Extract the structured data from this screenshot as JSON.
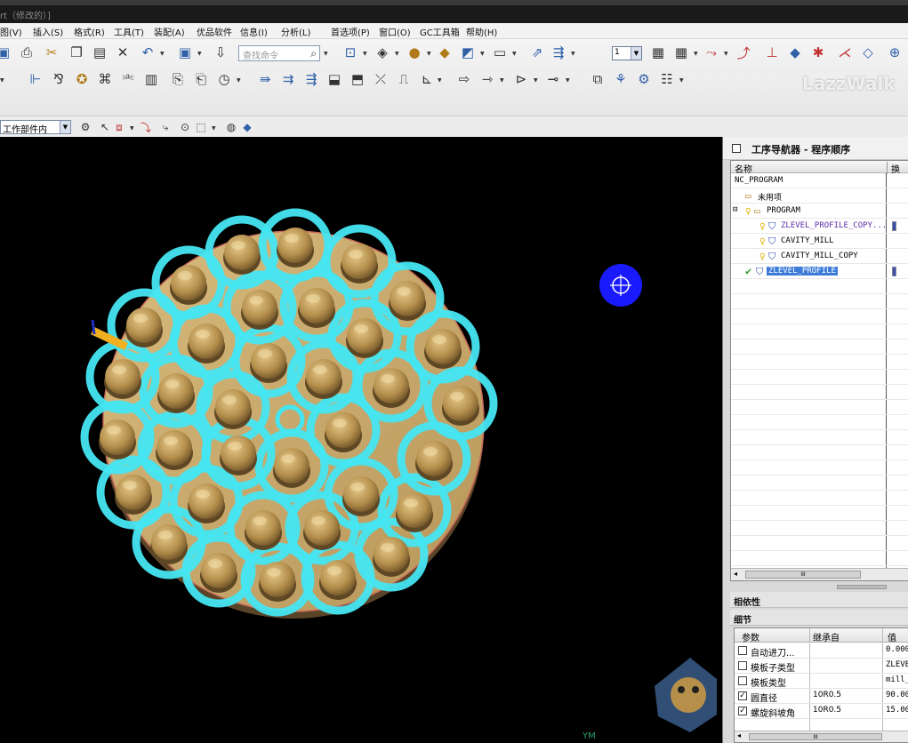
{
  "window": {
    "title": "rt（修改的）]"
  },
  "menu": {
    "items": [
      "图(V)",
      "插入(S)",
      "格式(R)",
      "工具(T)",
      "装配(A)",
      "优品软件",
      "信息(I)",
      "分析(L)",
      "首选项(P)",
      "窗口(O)",
      "GC工具箱",
      "帮助(H)"
    ]
  },
  "toolbar": {
    "search_placeholder": "查找命令",
    "layer_value": "1"
  },
  "watermark": {
    "text": "LazzWalk"
  },
  "selection": {
    "filter_value": "工作部件内"
  },
  "viewport": {
    "axis_label": "YM"
  },
  "navigator": {
    "title": "工序导航器 - 程序顺序",
    "col_name": "名称",
    "col_swap": "换",
    "root": "NC_PROGRAM",
    "unused": "未用项",
    "program": "PROGRAM",
    "ops": [
      {
        "name": "ZLEVEL_PROFILE_COPY..."
      },
      {
        "name": "CAVITY_MILL"
      },
      {
        "name": "CAVITY_MILL_COPY"
      },
      {
        "name": "ZLEVEL_PROFILE"
      }
    ],
    "hscroll_grip": "III"
  },
  "panels": {
    "dependency": "相依性",
    "details": "细节",
    "headers": {
      "param": "参数",
      "inherit": "继承自",
      "value": "值"
    },
    "rows": [
      {
        "param": "自动进刀...",
        "inherit": "",
        "value": "0.000",
        "checked": false
      },
      {
        "param": "模板子类型",
        "inherit": "",
        "value": "ZLEVE",
        "checked": false
      },
      {
        "param": "模板类型",
        "inherit": "",
        "value": "mill_",
        "checked": false
      },
      {
        "param": "圆直径",
        "inherit": "10R0.5",
        "value": "90.00",
        "checked": true
      },
      {
        "param": "螺旋斜坡角",
        "inherit": "10R0.5",
        "value": "15.00",
        "checked": true
      }
    ],
    "scroll_grip": "III"
  }
}
